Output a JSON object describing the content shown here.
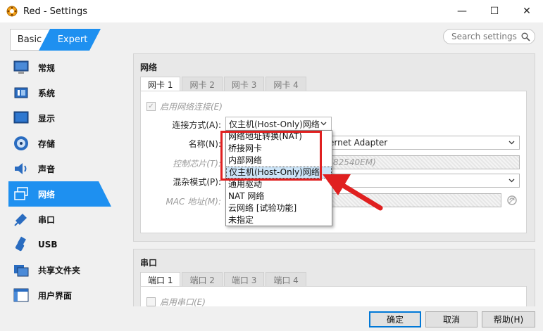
{
  "window": {
    "title": "Red - Settings",
    "minimize": "—",
    "maximize": "☐",
    "close": "✕"
  },
  "mode": {
    "basic": "Basic",
    "expert": "Expert"
  },
  "search": {
    "placeholder": "Search settings"
  },
  "sidebar": {
    "items": [
      {
        "label": "常规",
        "icon": "monitor-icon"
      },
      {
        "label": "系统",
        "icon": "chip-icon"
      },
      {
        "label": "显示",
        "icon": "display-icon"
      },
      {
        "label": "存储",
        "icon": "disk-icon"
      },
      {
        "label": "声音",
        "icon": "speaker-icon"
      },
      {
        "label": "网络",
        "icon": "network-icon",
        "active": true
      },
      {
        "label": "串口",
        "icon": "serial-icon"
      },
      {
        "label": "USB",
        "icon": "usb-icon"
      },
      {
        "label": "共享文件夹",
        "icon": "folder-icon"
      },
      {
        "label": "用户界面",
        "icon": "ui-icon"
      }
    ]
  },
  "network": {
    "title": "网络",
    "tabs": [
      "网卡 1",
      "网卡 2",
      "网卡 3",
      "网卡 4"
    ],
    "enable_label": "启用网络连接(E)",
    "attached_label": "连接方式(A):",
    "attached_value": "仅主机(Host-Only)网络",
    "name_label": "名称(N):",
    "name_value": "ernet Adapter",
    "chip_label": "控制芯片(T):",
    "chip_value": "82540EM)",
    "promisc_label": "混杂模式(P):",
    "mac_label": "MAC 地址(M):",
    "options": [
      "网络地址转换(NAT)",
      "桥接网卡",
      "内部网络",
      "仅主机(Host-Only)网络",
      "通用驱动",
      "NAT 网络",
      "云网络 [试验功能]",
      "未指定"
    ]
  },
  "serial": {
    "title": "串口",
    "tabs": [
      "端口 1",
      "端口 2",
      "端口 3",
      "端口 4"
    ],
    "enable_label": "启用串口(E)"
  },
  "buttons": {
    "ok": "确定",
    "cancel": "取消",
    "help": "帮助(H)"
  },
  "colors": {
    "accent": "#1e90f0",
    "highlight_box": "#e02020"
  }
}
